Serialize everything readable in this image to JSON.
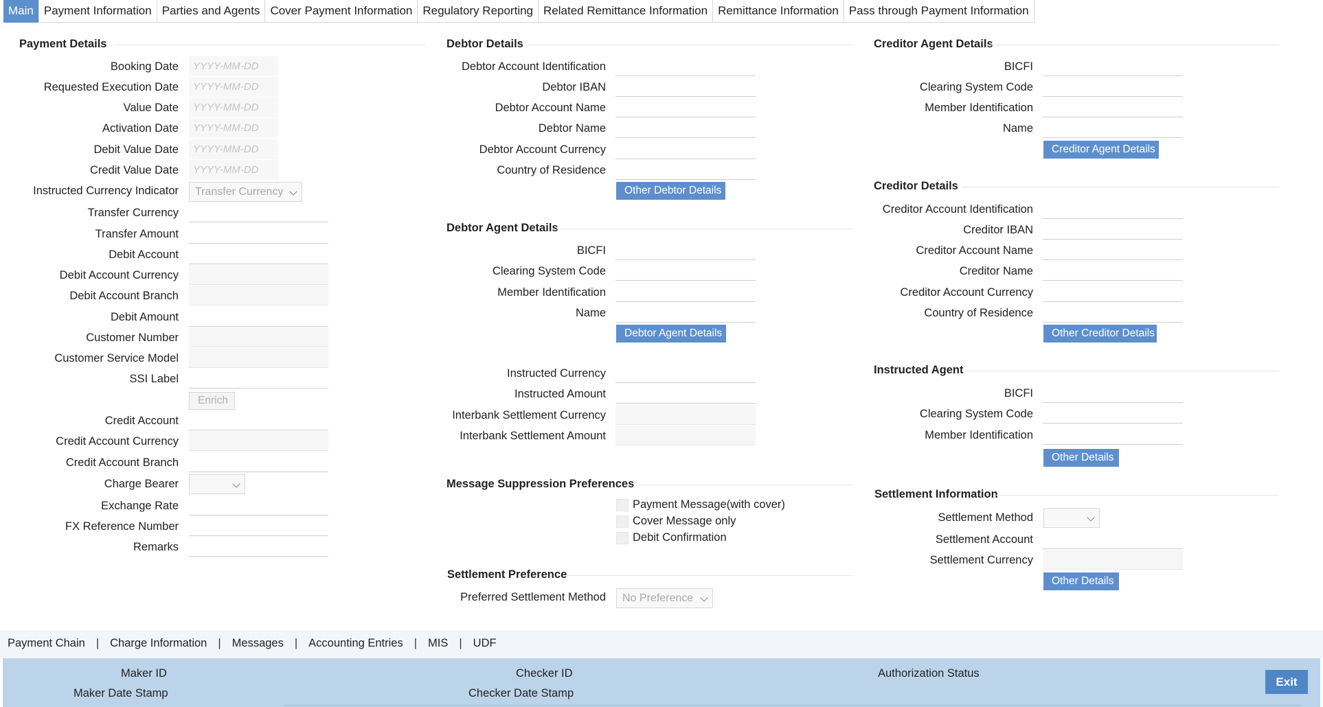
{
  "tabs": [
    "Main",
    "Payment Information",
    "Parties and Agents",
    "Cover Payment Information",
    "Regulatory Reporting",
    "Related Remittance Information",
    "Remittance Information",
    "Pass through Payment Information"
  ],
  "payment_details": {
    "title": "Payment Details",
    "date_placeholder": "YYYY-MM-DD",
    "booking_date": "Booking Date",
    "requested_execution_date": "Requested Execution Date",
    "value_date": "Value Date",
    "activation_date": "Activation Date",
    "debit_value_date": "Debit Value Date",
    "credit_value_date": "Credit Value Date",
    "instructed_currency_indicator": "Instructed Currency Indicator",
    "instructed_currency_indicator_value": "Transfer Currency",
    "transfer_currency": "Transfer Currency",
    "transfer_amount": "Transfer Amount",
    "debit_account": "Debit Account",
    "debit_account_currency": "Debit Account Currency",
    "debit_account_branch": "Debit Account Branch",
    "debit_amount": "Debit Amount",
    "customer_number": "Customer Number",
    "customer_service_model": "Customer Service Model",
    "ssi_label": "SSI Label",
    "enrich_button": "Enrich",
    "credit_account": "Credit Account",
    "credit_account_currency": "Credit Account Currency",
    "credit_account_branch": "Credit Account Branch",
    "charge_bearer": "Charge Bearer",
    "exchange_rate": "Exchange Rate",
    "fx_reference_number": "FX Reference Number",
    "remarks": "Remarks"
  },
  "debtor_details": {
    "title": "Debtor Details",
    "account_identification": "Debtor Account Identification",
    "iban": "Debtor IBAN",
    "account_name": "Debtor Account Name",
    "name": "Debtor Name",
    "account_currency": "Debtor Account Currency",
    "country_of_residence": "Country of Residence",
    "other_button": "Other Debtor Details"
  },
  "debtor_agent_details": {
    "title": "Debtor Agent Details",
    "bicfi": "BICFI",
    "clearing_system_code": "Clearing System Code",
    "member_identification": "Member Identification",
    "name": "Name",
    "button": "Debtor Agent Details"
  },
  "instructed": {
    "instructed_currency": "Instructed Currency",
    "instructed_amount": "Instructed Amount",
    "interbank_settlement_currency": "Interbank Settlement Currency",
    "interbank_settlement_amount": "Interbank Settlement Amount"
  },
  "message_suppression": {
    "title": "Message Suppression Preferences",
    "options": [
      "Payment Message(with cover)",
      "Cover Message only",
      "Debit Confirmation"
    ]
  },
  "settlement_preference": {
    "title": "Settlement Preference",
    "preferred_method": "Preferred Settlement Method",
    "preferred_method_value": "No Preference"
  },
  "creditor_agent_details": {
    "title": "Creditor Agent Details",
    "bicfi": "BICFI",
    "clearing_system_code": "Clearing System Code",
    "member_identification": "Member Identification",
    "name": "Name",
    "button": "Creditor Agent Details"
  },
  "creditor_details": {
    "title": "Creditor Details",
    "account_identification": "Creditor Account Identification",
    "iban": "Creditor IBAN",
    "account_name": "Creditor Account Name",
    "name": "Creditor Name",
    "account_currency": "Creditor Account Currency",
    "country_of_residence": "Country of Residence",
    "other_button": "Other Creditor Details"
  },
  "instructed_agent": {
    "title": "Instructed Agent",
    "bicfi": "BICFI",
    "clearing_system_code": "Clearing System Code",
    "member_identification": "Member Identification",
    "other_button": "Other Details"
  },
  "settlement_information": {
    "title": "Settlement Information",
    "settlement_method": "Settlement Method",
    "settlement_account": "Settlement Account",
    "settlement_currency": "Settlement Currency",
    "other_button": "Other Details"
  },
  "subnav": [
    "Payment Chain",
    "Charge Information",
    "Messages",
    "Accounting Entries",
    "MIS",
    "UDF"
  ],
  "footer": {
    "maker_id": "Maker ID",
    "maker_date_stamp": "Maker Date Stamp",
    "checker_id": "Checker ID",
    "checker_date_stamp": "Checker Date Stamp",
    "authorization_status": "Authorization Status",
    "exit_button": "Exit"
  }
}
